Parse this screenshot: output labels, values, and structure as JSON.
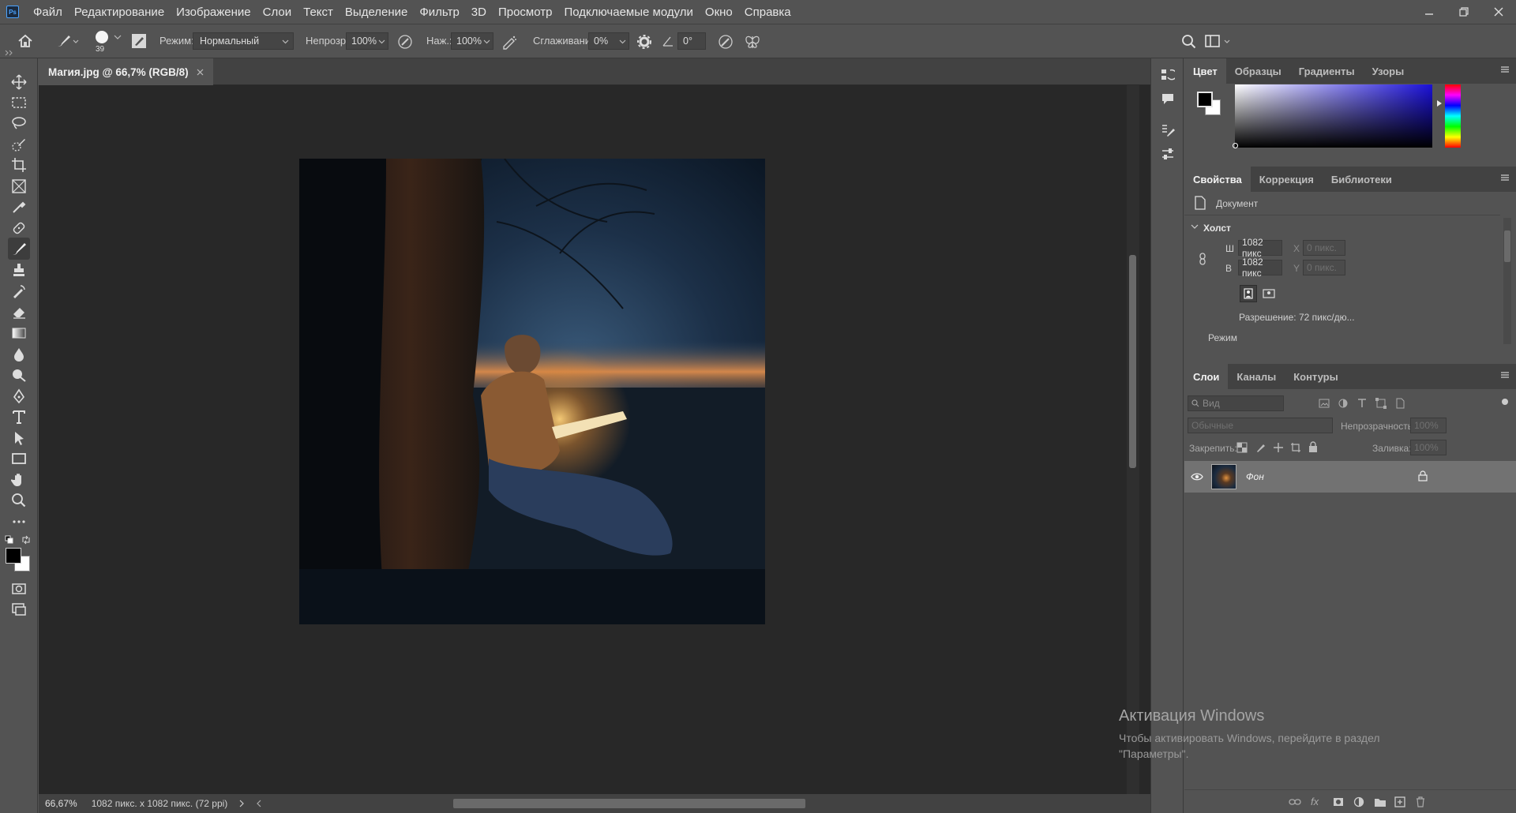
{
  "app": {
    "logo": "Ps"
  },
  "menu": [
    "Файл",
    "Редактирование",
    "Изображение",
    "Слои",
    "Текст",
    "Выделение",
    "Фильтр",
    "3D",
    "Просмотр",
    "Подключаемые модули",
    "Окно",
    "Справка"
  ],
  "options": {
    "brush_size": "39",
    "mode_label": "Режим:",
    "mode_value": "Нормальный",
    "opacity_label": "Непрозр.:",
    "opacity_value": "100%",
    "pressure_label": "Наж.:",
    "pressure_value": "100%",
    "smoothing_label": "Сглаживание:",
    "smoothing_value": "0%",
    "angle_value": "0°"
  },
  "document": {
    "tab_title": "Магия.jpg @ 66,7% (RGB/8)",
    "zoom": "66,67%",
    "info": "1082 пикс. x 1082 пикс. (72 ppi)"
  },
  "color_panel": {
    "tabs": [
      "Цвет",
      "Образцы",
      "Градиенты",
      "Узоры"
    ],
    "foreground": "#000000",
    "background": "#ffffff",
    "hue_color": "#1a10d8"
  },
  "properties": {
    "tabs": [
      "Свойства",
      "Коррекция",
      "Библиотеки"
    ],
    "doc_label": "Документ",
    "section": "Холст",
    "w_label": "Ш",
    "w_value": "1082 пикс",
    "h_label": "В",
    "h_value": "1082 пикс",
    "x_label": "X",
    "x_value": "0 пикс.",
    "y_label": "Y",
    "y_value": "0 пикс.",
    "resolution": "Разрешение: 72 пикс/дю...",
    "mode": "Режим"
  },
  "layers": {
    "tabs": [
      "Слои",
      "Каналы",
      "Контуры"
    ],
    "filter_placeholder": "Вид",
    "blend": "Обычные",
    "opacity_label": "Непрозрачность:",
    "opacity_value": "100%",
    "lock_label": "Закрепить:",
    "fill_label": "Заливка:",
    "fill_value": "100%",
    "items": [
      {
        "name": "Фон",
        "visible": true,
        "locked": true
      }
    ]
  },
  "watermark": {
    "title": "Активация Windows",
    "line1": "Чтобы активировать Windows, перейдите в раздел",
    "line2": "\"Параметры\"."
  }
}
